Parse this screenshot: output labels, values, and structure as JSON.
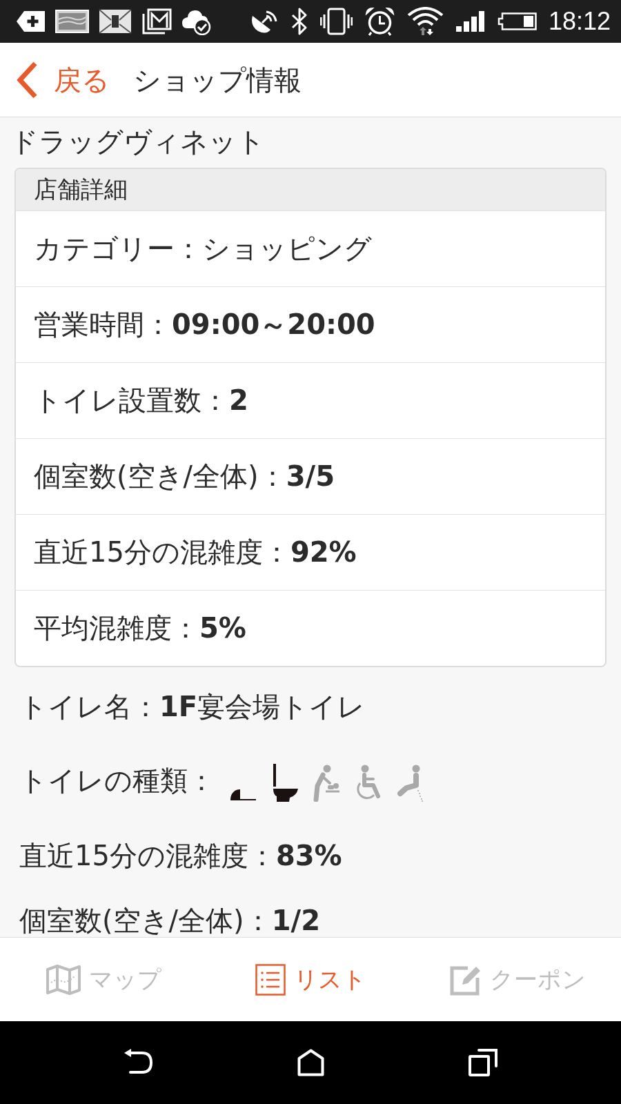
{
  "status_bar": {
    "time": "18:12"
  },
  "header": {
    "back_label": "戻る",
    "title": "ショップ情報"
  },
  "shop": {
    "name": "ドラッグヴィネット"
  },
  "details": {
    "title": "店舗詳細",
    "rows": [
      "カテゴリー：ショッピング",
      "営業時間：**09:00～20:00**",
      "トイレ設置数：**2**",
      "個室数(空き/全体)：**3/5**",
      "直近15分の混雑度：**92%**",
      "平均混雑度：**5%**"
    ]
  },
  "toilet": {
    "name": "トイレ名：**1F**宴会場トイレ",
    "types_label": "トイレの種類：",
    "types": [
      {
        "kind": "squat",
        "available": true
      },
      {
        "kind": "western",
        "available": true
      },
      {
        "kind": "baby_changing",
        "available": false
      },
      {
        "kind": "wheelchair",
        "available": false
      },
      {
        "kind": "washlet",
        "available": false
      }
    ],
    "congestion": "直近15分の混雑度：**83%**",
    "rooms": "個室数(空き/全体)：**1/2**"
  },
  "tabs": [
    {
      "kind": "map",
      "label": "マップ",
      "selected": false
    },
    {
      "kind": "list",
      "label": "リスト",
      "selected": true
    },
    {
      "kind": "coupon",
      "label": "クーポン",
      "selected": false
    }
  ]
}
